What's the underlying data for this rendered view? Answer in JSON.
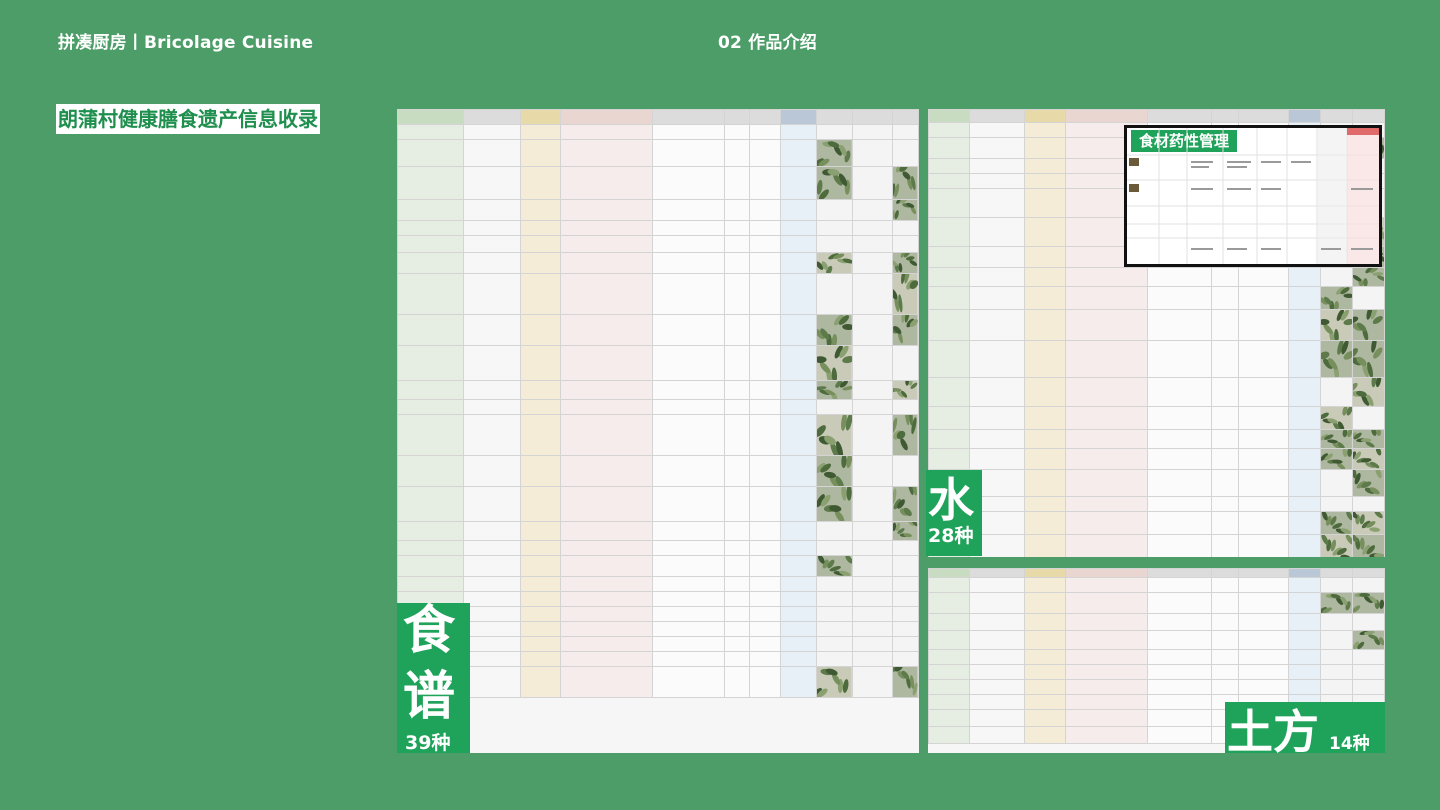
{
  "header": {
    "left_title": "拼凑厨房丨Bricolage Cuisine",
    "section": "02 作品介绍"
  },
  "page_title": "朗蒲村健康膳食遗产信息收录",
  "panels": {
    "recipes": {
      "big_char_1": "食",
      "big_char_2": "谱",
      "count": "39种"
    },
    "water": {
      "big_char": "水",
      "count": "28种"
    },
    "earth": {
      "big_char": "土方",
      "count": "14种"
    },
    "medicinal": {
      "title": "食材药性管理"
    }
  },
  "colors": {
    "background": "#4c9d67",
    "label_green": "#1fa35a",
    "title_text": "#1f8f4e"
  }
}
